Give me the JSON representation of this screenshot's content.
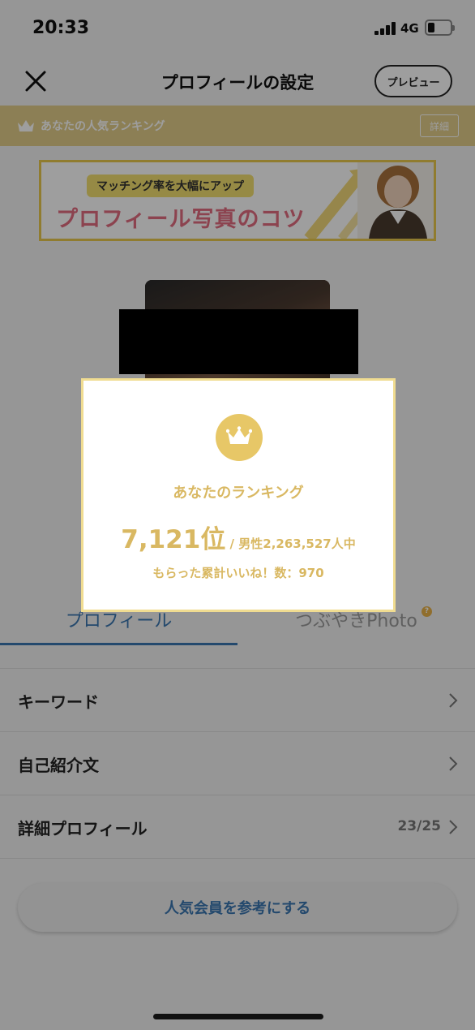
{
  "status_bar": {
    "time": "20:33",
    "network": "4G"
  },
  "header": {
    "title": "プロフィールの設定",
    "preview_label": "プレビュー"
  },
  "ranking_bar": {
    "label": "あなたの人気ランキング",
    "details_label": "詳細"
  },
  "banner": {
    "subtitle": "マッチング率を大幅にアップ",
    "headline": "プロフィール写真のコツ"
  },
  "tabs": [
    {
      "label": "プロフィール",
      "active": true
    },
    {
      "label": "つぶやきPhoto",
      "active": false,
      "badge": "?"
    }
  ],
  "menu": [
    {
      "label": "キーワード",
      "value": ""
    },
    {
      "label": "自己紹介文",
      "value": ""
    },
    {
      "label": "詳細プロフィール",
      "value": "23/25"
    }
  ],
  "popular_button_label": "人気会員を参考にする",
  "modal": {
    "title": "あなたのランキング",
    "rank": "7,121位",
    "total": " / 男性2,263,527人中",
    "likes": "もらった累計いいね！数：970"
  },
  "colors": {
    "gold": "#e3cd8a",
    "modal_gold": "#d9b862",
    "accent_blue": "#3a76b0",
    "banner_pink": "#e26c80"
  },
  "icons": [
    "close-icon",
    "crown-icon",
    "chevron-right-icon"
  ]
}
